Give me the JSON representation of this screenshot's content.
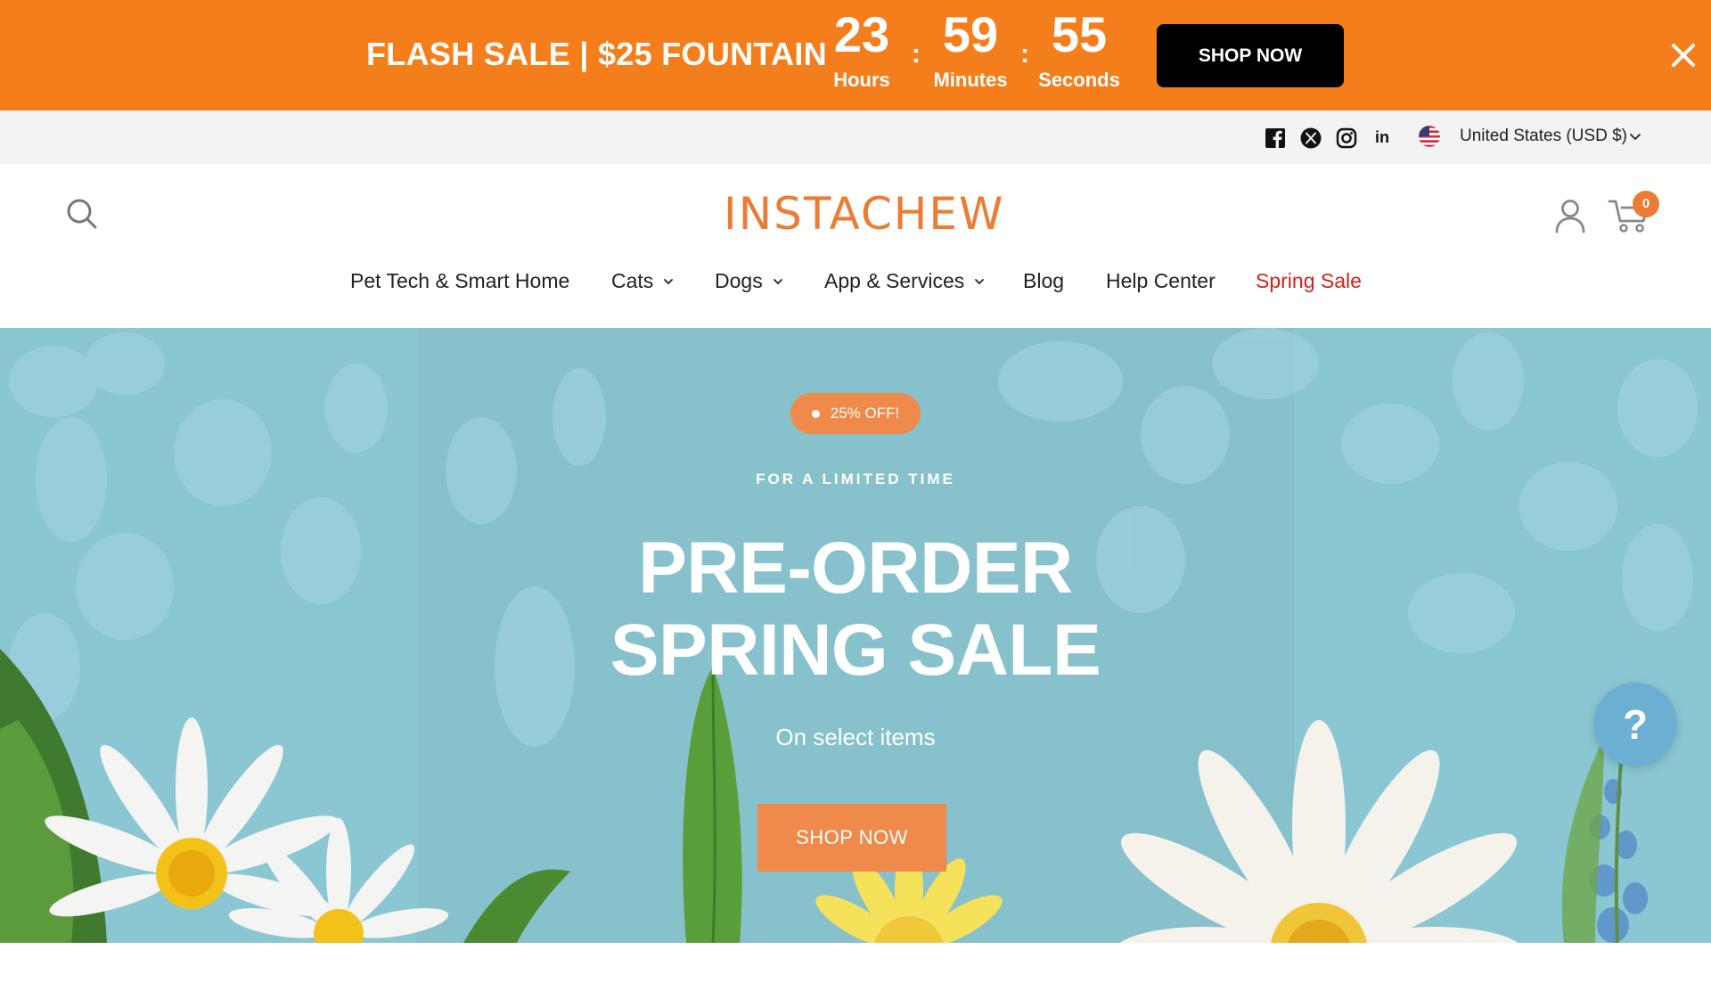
{
  "promo_bar": {
    "title": "FLASH SALE | $25 FOUNTAIN",
    "countdown": {
      "hours": "23",
      "hours_label": "Hours",
      "minutes": "59",
      "minutes_label": "Minutes",
      "seconds": "55",
      "seconds_label": "Seconds",
      "separator": ":"
    },
    "button_label": "SHOP NOW",
    "close_icon": "close-icon",
    "background": "#f47e1b"
  },
  "utility_bar": {
    "social_icons": [
      "facebook-icon",
      "x-twitter-icon",
      "instagram-icon",
      "linkedin-icon"
    ],
    "linkedin_text": "in",
    "currency": "United States (USD $)",
    "flag_icon": "us-flag-icon"
  },
  "header": {
    "logo_text": "INSTACHEW",
    "search_icon": "search-icon",
    "account_icon": "account-icon",
    "cart_icon": "cart-icon",
    "cart_count": "0",
    "brand_color": "#ea7d33"
  },
  "nav": {
    "items": [
      {
        "label": "Pet Tech & Smart Home"
      },
      {
        "label": "Cats"
      },
      {
        "label": "Dogs"
      },
      {
        "label": "App & Services"
      },
      {
        "label": "Blog"
      },
      {
        "label": "Help Center"
      },
      {
        "label": "Spring Sale"
      }
    ],
    "sale_color": "#d0231c"
  },
  "hero": {
    "badge": "25% OFF!",
    "eyebrow": "FOR A LIMITED TIME",
    "title_line1": "PRE-ORDER",
    "title_line2": "SPRING SALE",
    "subtitle": "On select items",
    "button_label": "SHOP NOW",
    "accent": "#f08a4b",
    "background": "#8ac7d3"
  },
  "help_widget": {
    "label": "?"
  }
}
